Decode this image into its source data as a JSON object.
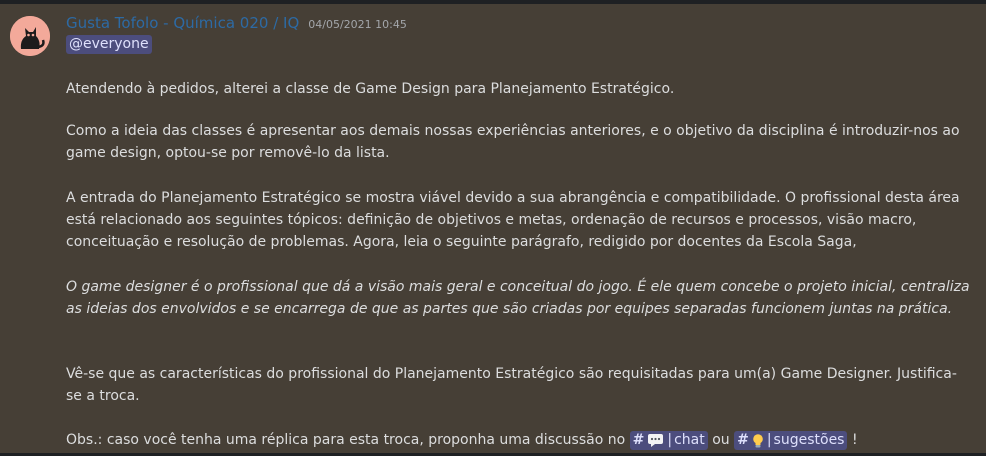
{
  "author": {
    "name": "Gusta Tofolo - Química 020 / IQ",
    "timestamp": "04/05/2021 10:45",
    "avatar_icon": "cat-icon"
  },
  "mention": "@everyone",
  "paragraphs": {
    "p1": "Atendendo à pedidos, alterei a classe de Game Design para Planejamento Estratégico.",
    "p2": "Como a ideia das classes é apresentar aos demais nossas experiências anteriores, e o objetivo da disciplina é introduzir-nos ao game design, optou-se por removê-lo da lista.",
    "p3": "A entrada do Planejamento Estratégico se mostra viável devido a sua abrangência e compatibilidade. O profissional desta área está relacionado aos seguintes tópicos: definição de objetivos e metas, ordenação de recursos e processos, visão macro, conceituação e resolução de problemas. Agora, leia o seguinte parágrafo, redigido por docentes da Escola Saga,",
    "p4": "O game designer é o profissional que dá a visão mais geral e conceitual do jogo. É ele quem concebe o projeto inicial, centraliza as ideias dos envolvidos e se encarrega de que as partes que são criadas por equipes separadas funcionem juntas na prática.",
    "p5": "Vê-se que as características do profissional do Planejamento Estratégico são requisitadas para um(a) Game Designer. Justifica-se a troca.",
    "p6_prefix": "Obs.: caso você tenha uma réplica para esta troca, proponha uma discussão no",
    "p6_connector": "ou",
    "p6_suffix": "!"
  },
  "channels": {
    "chat": {
      "hash": "#",
      "emoji": "speech-bubble-icon",
      "bar": "|",
      "name": "chat"
    },
    "sugestoes": {
      "hash": "#",
      "emoji": "lightbulb-icon",
      "bar": "|",
      "name": "sugestões"
    }
  },
  "colors": {
    "message_bg": "#463f36",
    "username": "#2d6aa4",
    "mention_bg": "#5865f2",
    "text": "#dcddde"
  }
}
